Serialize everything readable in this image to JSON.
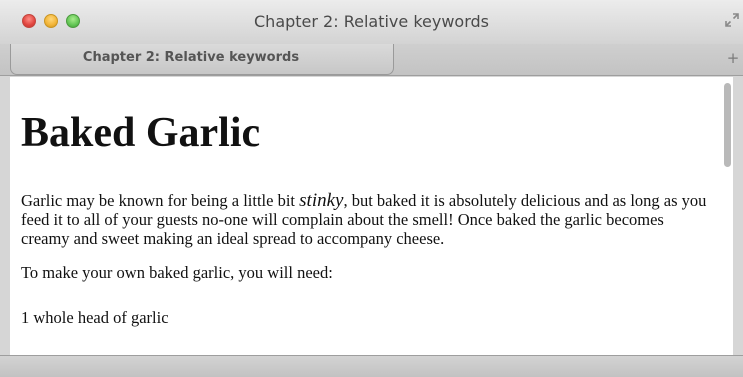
{
  "window": {
    "title": "Chapter 2: Relative keywords"
  },
  "tabs": [
    {
      "label": "Chapter 2: Relative keywords"
    }
  ],
  "toolbar": {
    "new_tab_label": "+"
  },
  "page": {
    "heading": "Baked Garlic",
    "intro": {
      "before": "Garlic may be known for being a little bit ",
      "emphasis": "stinky",
      "after": ", but baked it is absolutely delicious and as long as you feed it to all of your guests no-one will complain about the smell! Once baked the garlic becomes creamy and sweet making an ideal spread to accompany cheese."
    },
    "need_text": "To make your own baked garlic, you will need:",
    "cut_off_line": "1 whole head of garlic"
  },
  "icons": {
    "close": "close-window-icon",
    "minimize": "minimize-window-icon",
    "zoom": "zoom-window-icon",
    "fullscreen": "fullscreen-icon"
  },
  "colors": {
    "close": "#e0443e",
    "minimize": "#f2b437",
    "zoom": "#62c554"
  }
}
